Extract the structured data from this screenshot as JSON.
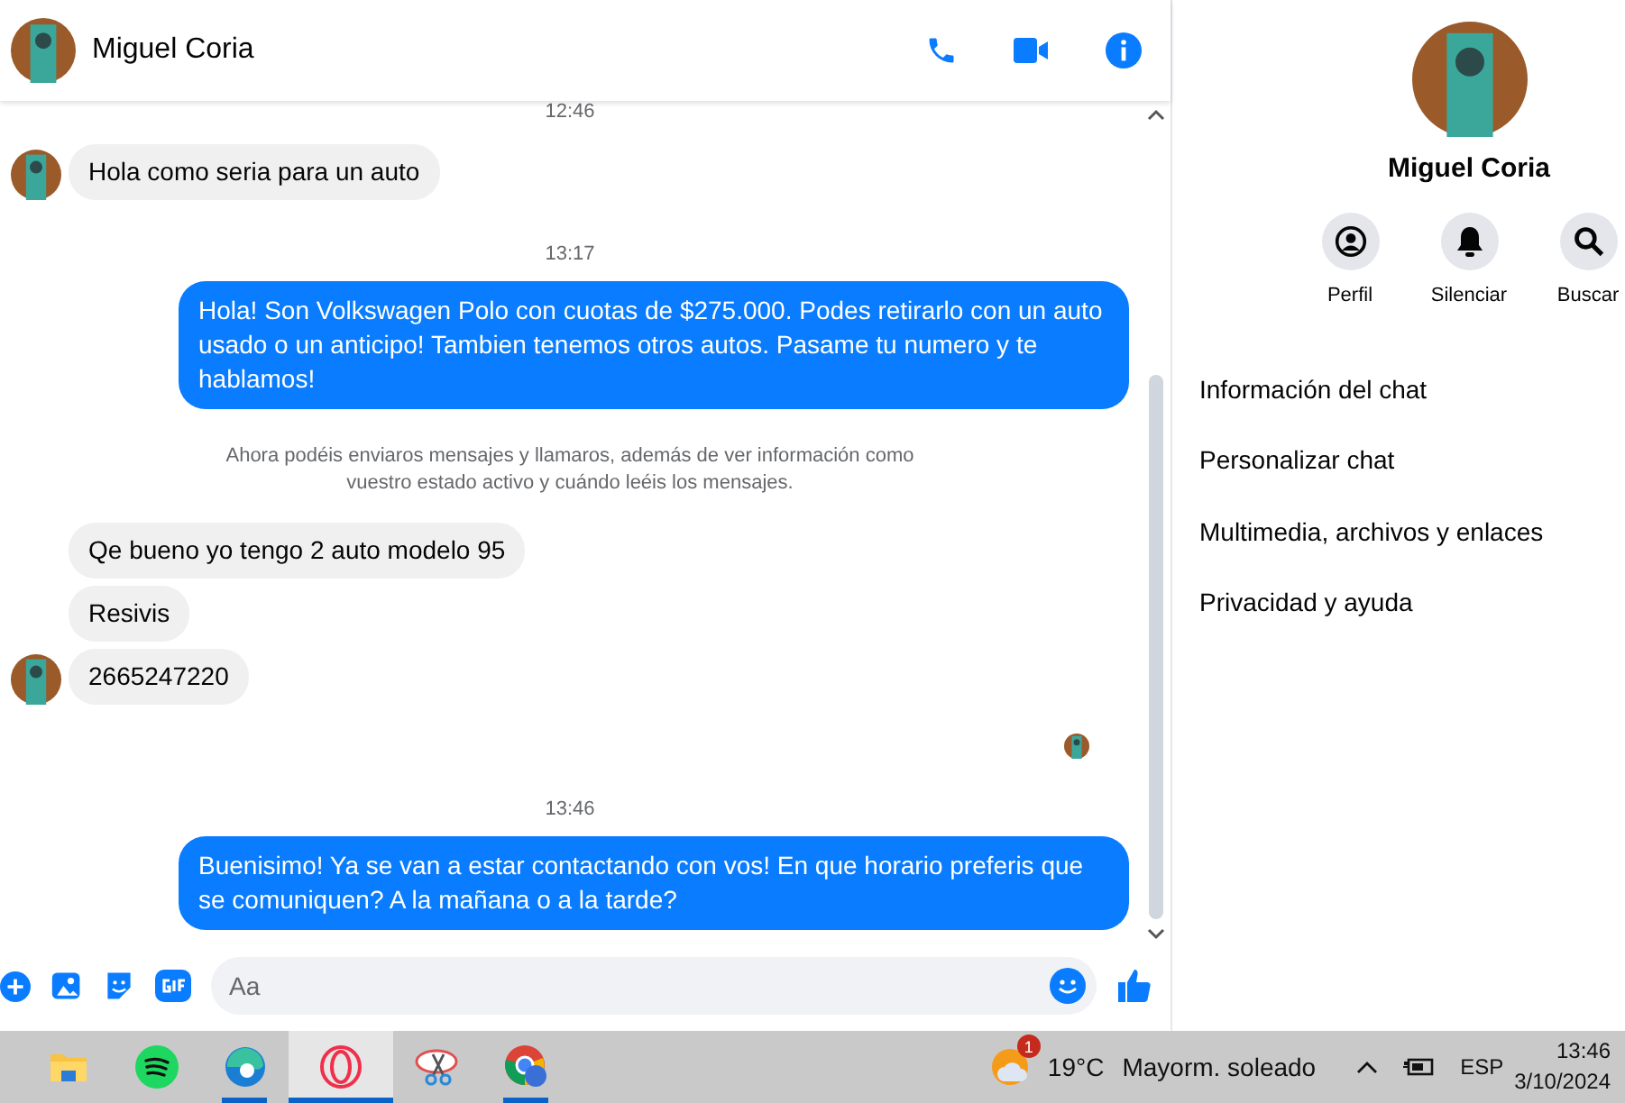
{
  "header": {
    "name": "Miguel Coria"
  },
  "messages": [
    {
      "kind": "time",
      "text": "12:46"
    },
    {
      "kind": "incoming",
      "text": "Hola como seria para un auto",
      "avatar": true
    },
    {
      "kind": "time",
      "text": "13:17"
    },
    {
      "kind": "outgoing",
      "text": "Hola! Son Volkswagen Polo con cuotas de $275.000. Podes retirarlo con un auto usado o un anticipo! Tambien tenemos otros autos. Pasame tu numero y te hablamos!"
    },
    {
      "kind": "notice",
      "text": "Ahora podéis enviaros mensajes y llamaros, además de ver información como vuestro estado activo y cuándo leéis los mensajes."
    },
    {
      "kind": "incoming",
      "text": "Qe bueno yo tengo 2 auto modelo 95",
      "avatar": false
    },
    {
      "kind": "incoming",
      "text": "Resivis",
      "avatar": false
    },
    {
      "kind": "incoming",
      "text": "2665247220",
      "avatar": true
    },
    {
      "kind": "seen"
    },
    {
      "kind": "time",
      "text": "13:46"
    },
    {
      "kind": "outgoing",
      "text": "Buenisimo! Ya se van a estar contactando con vos! En que horario preferis que se comuniquen? A la mañana o a la tarde?"
    }
  ],
  "composer": {
    "placeholder": "Aa"
  },
  "panel": {
    "name": "Miguel Coria",
    "actions": [
      {
        "label": "Perfil"
      },
      {
        "label": "Silenciar"
      },
      {
        "label": "Buscar"
      }
    ],
    "menu": [
      "Información del chat",
      "Personalizar chat",
      "Multimedia, archivos y enlaces",
      "Privacidad y ayuda"
    ]
  },
  "taskbar": {
    "apps": [
      {
        "running": false,
        "selected": false
      },
      {
        "running": false,
        "selected": false
      },
      {
        "running": true,
        "selected": false
      },
      {
        "running": true,
        "selected": true
      },
      {
        "running": false,
        "selected": false
      },
      {
        "running": true,
        "selected": false
      }
    ],
    "weather": {
      "badge": "1",
      "temp": "19°C",
      "text": "Mayorm. soleado"
    },
    "lang": "ESP",
    "time": "13:46",
    "date": "3/10/2024"
  }
}
